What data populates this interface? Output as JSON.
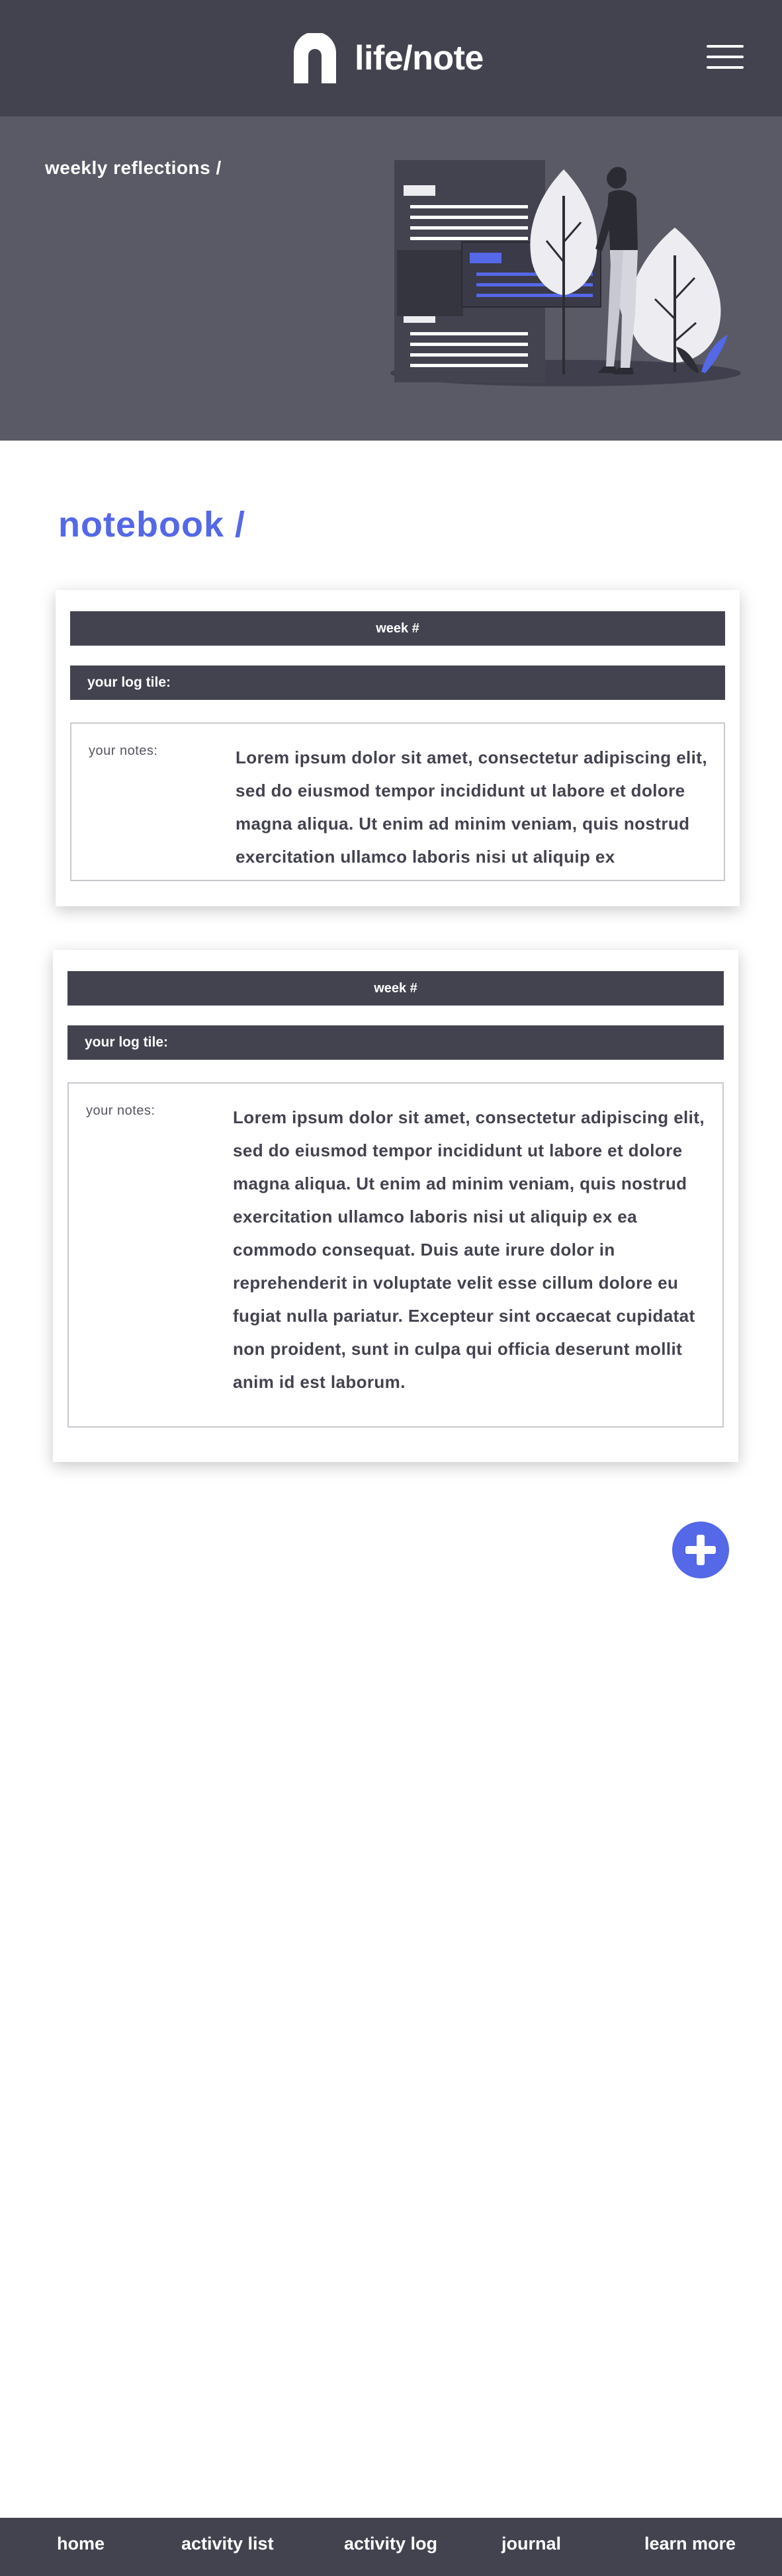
{
  "header": {
    "app_name": "life/note",
    "logo_icon": "arch-logo-icon",
    "menu_icon": "hamburger-menu-icon"
  },
  "hero": {
    "title": "weekly reflections /",
    "illustration": "person-with-document-board-illustration"
  },
  "notebook": {
    "title": "notebook /",
    "entries": [
      {
        "week_label": "week #",
        "title_label": "your log tile:",
        "notes_label": "your notes:",
        "notes_text": "Lorem ipsum dolor sit amet, consectetur adipiscing elit, sed do eiusmod tempor incididunt ut labore et dolore magna aliqua. Ut enim ad minim veniam, quis nostrud exercitation ullamco laboris nisi ut aliquip ex"
      },
      {
        "week_label": "week #",
        "title_label": "your log tile:",
        "notes_label": "your notes:",
        "notes_text": "Lorem ipsum dolor sit amet, consectetur adipiscing elit, sed do eiusmod tempor incididunt ut labore et dolore magna aliqua. Ut enim ad minim veniam, quis nostrud exercitation ullamco laboris nisi ut aliquip ex ea commodo consequat. Duis aute irure dolor in reprehenderit in voluptate velit esse cillum dolore eu fugiat nulla pariatur. Excepteur sint occaecat cupidatat non proident, sunt in culpa qui officia deserunt mollit anim id est laborum."
      }
    ],
    "add_button_icon": "plus-icon"
  },
  "footer_nav": [
    {
      "label": "home"
    },
    {
      "label": "activity list"
    },
    {
      "label": "activity log"
    },
    {
      "label": "journal"
    },
    {
      "label": "learn more"
    }
  ],
  "colors": {
    "header_bg": "#434350",
    "hero_bg": "#5a5a66",
    "accent": "#5468e8",
    "text_dark": "#434350"
  }
}
